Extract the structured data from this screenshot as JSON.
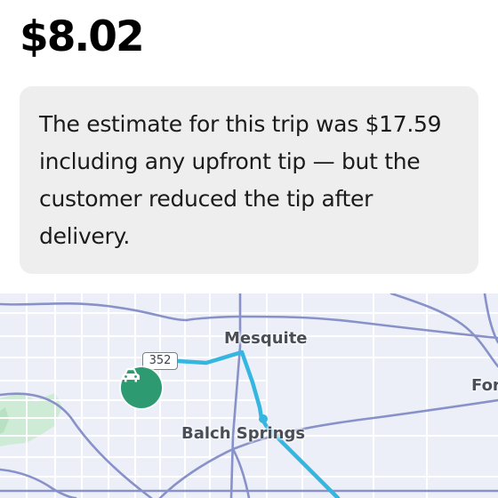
{
  "earnings": {
    "amount": "$8.02"
  },
  "notice": {
    "text": "The estimate for this trip was $17.59 including any upfront tip — but the customer reduced the tip after delivery."
  },
  "map": {
    "labels": {
      "mesquite": "Mesquite",
      "balch_springs": "Balch Springs",
      "forney_partial": "For"
    },
    "highway_shield": "352",
    "route_color": "#35b6e0",
    "driver_marker_color": "#2e9a72",
    "driver_icon": "car-icon"
  }
}
